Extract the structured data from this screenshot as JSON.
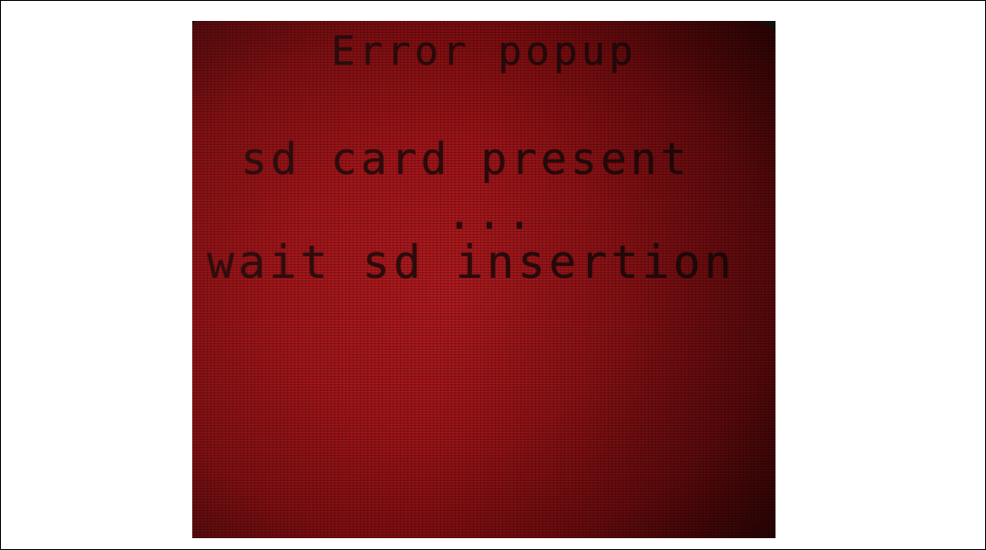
{
  "popup": {
    "title": "Error popup",
    "message_line1": "sd card present",
    "message_line2": "...",
    "message_line3": "wait sd insertion"
  },
  "colors": {
    "lcd_background": "#a01418",
    "lcd_text": "#1a0a0a",
    "page_background": "#ffffff"
  }
}
